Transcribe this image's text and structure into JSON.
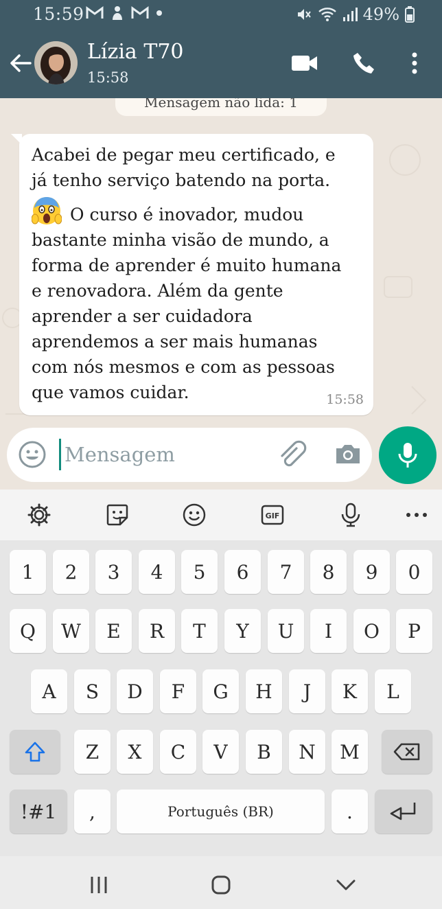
{
  "status_bar": {
    "time": "15:59",
    "left_icons": [
      "gmail-icon",
      "hand-icon",
      "gmail-icon",
      "dot-icon"
    ],
    "battery": "49%",
    "right_icons": [
      "mute-icon",
      "wifi-icon",
      "signal-icon",
      "battery-icon"
    ]
  },
  "header": {
    "contact_name": "Lízia T70",
    "subtitle": "15:58",
    "icons": [
      "back-arrow-icon",
      "video-call-icon",
      "voice-call-icon",
      "more-menu-icon"
    ]
  },
  "chat": {
    "unread_banner": "Mensagem não lida: 1",
    "message": {
      "line1": "Acabei de pegar meu certificado, e",
      "line2": "já tenho serviço batendo na porta.",
      "line3": "O curso é inovador, mudou",
      "line4": "bastante minha visão de mundo, a",
      "line5": "forma de aprender é muito humana",
      "line6": "e renovadora. Além da gente",
      "line7": "aprender a ser cuidadora",
      "line8": "aprendemos a ser mais humanas",
      "line9": "com nós mesmos e com as pessoas",
      "line10": "que vamos cuidar.",
      "emoji": "face-screaming-in-fear",
      "time": "15:58"
    }
  },
  "compose": {
    "placeholder": "Mensagem",
    "icons": [
      "emoji-icon",
      "attach-icon",
      "camera-icon",
      "mic-icon"
    ]
  },
  "keyboard": {
    "toolbar": [
      "settings-icon",
      "sticker-icon",
      "emoji-icon",
      "gif-icon",
      "voice-input-icon",
      "more-icon"
    ],
    "gif_label": "GIF",
    "row_numbers": [
      "1",
      "2",
      "3",
      "4",
      "5",
      "6",
      "7",
      "8",
      "9",
      "0"
    ],
    "row1": [
      "Q",
      "W",
      "E",
      "R",
      "T",
      "Y",
      "U",
      "I",
      "O",
      "P"
    ],
    "row2": [
      "A",
      "S",
      "D",
      "F",
      "G",
      "H",
      "J",
      "K",
      "L"
    ],
    "row3": [
      "Z",
      "X",
      "C",
      "V",
      "B",
      "N",
      "M"
    ],
    "symbols_label": "!#1",
    "comma": ",",
    "space_label": "Português (BR)",
    "period": ".",
    "special_icons": [
      "shift-icon",
      "backspace-icon",
      "enter-icon"
    ]
  },
  "nav_bar": [
    "recents-icon",
    "home-icon",
    "back-icon"
  ],
  "colors": {
    "header": "#3f5a66",
    "chat_bg": "#ece5dd",
    "accent_green": "#00a884",
    "caret": "#128c7e"
  }
}
